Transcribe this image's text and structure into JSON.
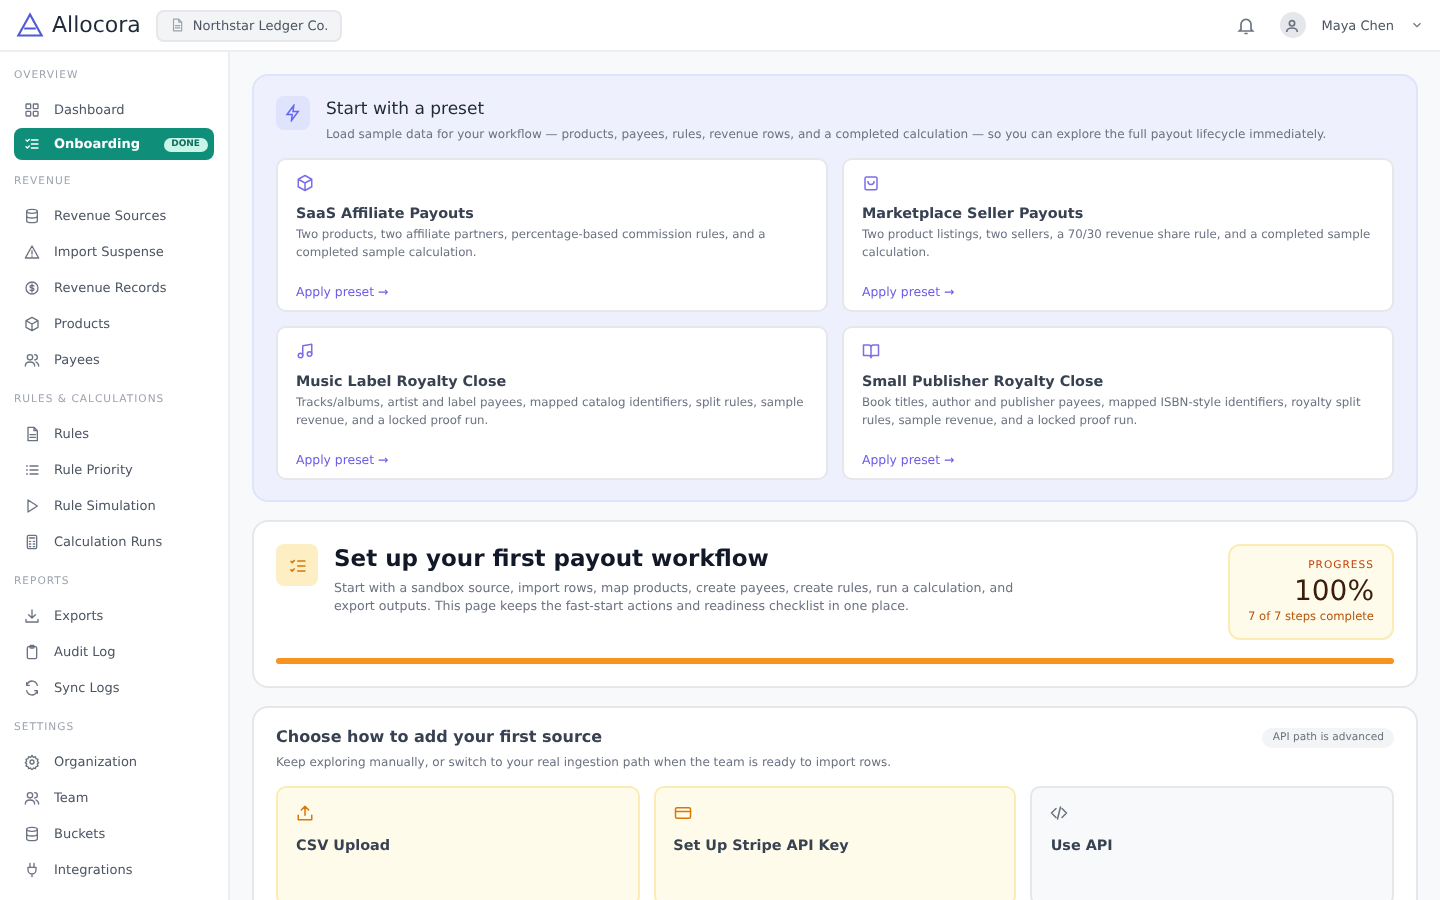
{
  "header": {
    "logo": "Allocora",
    "org": "Northstar Ledger Co.",
    "user": "Maya Chen"
  },
  "sidebar": {
    "sections": [
      {
        "title": "OVERVIEW",
        "items": [
          {
            "label": "Dashboard",
            "kind": "grid",
            "selected": false
          },
          {
            "label": "Onboarding",
            "kind": "checklist",
            "selected": true,
            "badge": "DONE"
          }
        ]
      },
      {
        "title": "REVENUE",
        "items": [
          {
            "label": "Revenue Sources",
            "kind": "database",
            "selected": false
          },
          {
            "label": "Import Suspense",
            "kind": "warning",
            "selected": false
          },
          {
            "label": "Revenue Records",
            "kind": "dollar",
            "selected": false
          },
          {
            "label": "Products",
            "kind": "box",
            "selected": false
          },
          {
            "label": "Payees",
            "kind": "users",
            "selected": false
          }
        ]
      },
      {
        "title": "RULES & CALCULATIONS",
        "items": [
          {
            "label": "Rules",
            "kind": "doc",
            "selected": false
          },
          {
            "label": "Rule Priority",
            "kind": "list",
            "selected": false
          },
          {
            "label": "Rule Simulation",
            "kind": "play",
            "selected": false
          },
          {
            "label": "Calculation Runs",
            "kind": "calc",
            "selected": false
          }
        ]
      },
      {
        "title": "REPORTS",
        "items": [
          {
            "label": "Exports",
            "kind": "download",
            "selected": false
          },
          {
            "label": "Audit Log",
            "kind": "clipboard",
            "selected": false
          },
          {
            "label": "Sync Logs",
            "kind": "sync",
            "selected": false
          }
        ]
      },
      {
        "title": "SETTINGS",
        "items": [
          {
            "label": "Organization",
            "kind": "gear",
            "selected": false
          },
          {
            "label": "Team",
            "kind": "users",
            "selected": false
          },
          {
            "label": "Buckets",
            "kind": "database",
            "selected": false
          },
          {
            "label": "Integrations",
            "kind": "plug",
            "selected": false
          }
        ]
      }
    ]
  },
  "preset": {
    "title": "Start with a preset",
    "description": "Load sample data for your workflow — products, payees, rules, revenue rows, and a completed calculation — so you can explore the full payout lifecycle immediately.",
    "cards": [
      {
        "kind": "box",
        "title": "SaaS Affiliate Payouts",
        "description": "Two products, two affiliate partners, percentage-based commission rules, and a completed sample calculation.",
        "link": "Apply preset →"
      },
      {
        "kind": "bag",
        "title": "Marketplace Seller Payouts",
        "description": "Two product listings, two sellers, a 70/30 revenue share rule, and a completed sample calculation.",
        "link": "Apply preset →"
      },
      {
        "kind": "music",
        "title": "Music Label Royalty Close",
        "description": "Tracks/albums, artist and label payees, mapped catalog identifiers, split rules, sample revenue, and a locked proof run.",
        "link": "Apply preset →"
      },
      {
        "kind": "book",
        "title": "Small Publisher Royalty Close",
        "description": "Book titles, author and publisher payees, mapped ISBN-style identifiers, royalty split rules, sample revenue, and a locked proof run.",
        "link": "Apply preset →"
      }
    ]
  },
  "workflow": {
    "title": "Set up your first payout workflow",
    "description": "Start with a sandbox source, import rows, map products, create payees, create rules, run a calculation, and export outputs. This page keeps the fast-start actions and readiness checklist in one place.",
    "progress_label": "PROGRESS",
    "percent": "100%",
    "caption": "7 of 7 steps complete",
    "level": 1
  },
  "source": {
    "title": "Choose how to add your first source",
    "description": "Keep exploring manually, or switch to your real ingestion path when the team is ready to import rows.",
    "badge": "API path is advanced",
    "options": [
      {
        "kind": "upload",
        "title": "CSV Upload"
      },
      {
        "kind": "card",
        "title": "Set Up Stripe API Key"
      },
      {
        "kind": "code",
        "title": "Use API"
      }
    ]
  }
}
